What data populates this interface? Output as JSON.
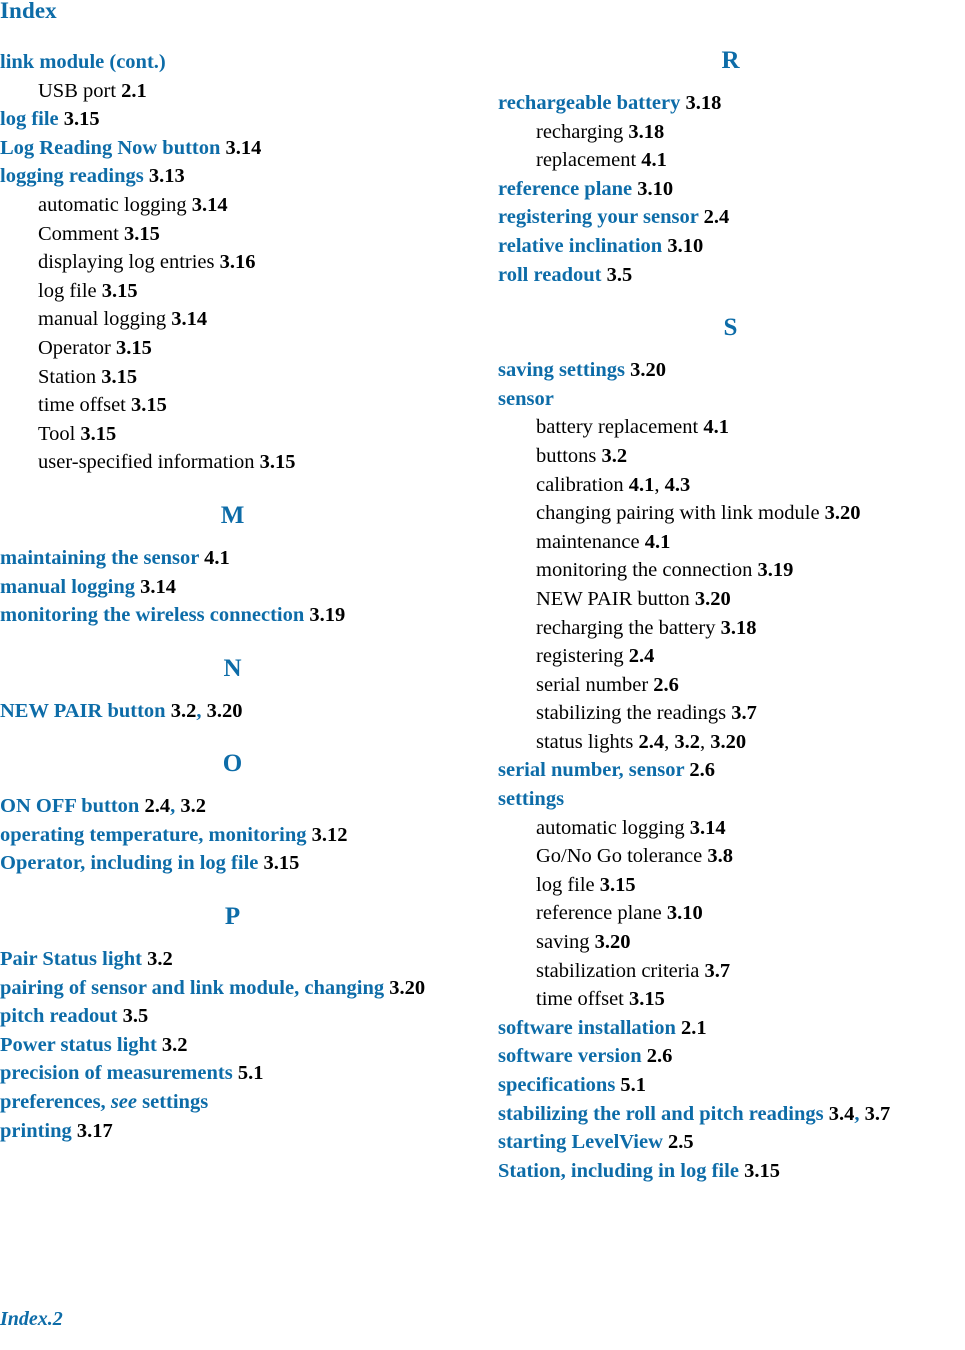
{
  "page": {
    "title": "Index",
    "footer": "Index.2"
  },
  "columns": [
    {
      "id": "left",
      "groups": [
        {
          "letter": null,
          "entries": [
            {
              "label": "link module (cont.)",
              "pages": [],
              "subs": [
                {
                  "label": "USB port",
                  "pages": [
                    "2.1"
                  ]
                }
              ]
            },
            {
              "label": "log file",
              "pages": [
                "3.15"
              ],
              "subs": []
            },
            {
              "label": "Log Reading Now button",
              "pages": [
                "3.14"
              ],
              "subs": []
            },
            {
              "label": "logging readings",
              "pages": [
                "3.13"
              ],
              "subs": [
                {
                  "label": "automatic logging",
                  "pages": [
                    "3.14"
                  ]
                },
                {
                  "label": "Comment",
                  "pages": [
                    "3.15"
                  ]
                },
                {
                  "label": "displaying log entries",
                  "pages": [
                    "3.16"
                  ]
                },
                {
                  "label": "log file",
                  "pages": [
                    "3.15"
                  ]
                },
                {
                  "label": "manual logging",
                  "pages": [
                    "3.14"
                  ]
                },
                {
                  "label": "Operator",
                  "pages": [
                    "3.15"
                  ]
                },
                {
                  "label": "Station",
                  "pages": [
                    "3.15"
                  ]
                },
                {
                  "label": "time offset",
                  "pages": [
                    "3.15"
                  ]
                },
                {
                  "label": "Tool",
                  "pages": [
                    "3.15"
                  ]
                },
                {
                  "label": "user-specified information",
                  "pages": [
                    "3.15"
                  ]
                }
              ]
            }
          ]
        },
        {
          "letter": "M",
          "entries": [
            {
              "label": "maintaining the sensor",
              "pages": [
                "4.1"
              ],
              "subs": []
            },
            {
              "label": "manual logging",
              "pages": [
                "3.14"
              ],
              "subs": []
            },
            {
              "label": "monitoring the wireless connection",
              "pages": [
                "3.19"
              ],
              "subs": []
            }
          ]
        },
        {
          "letter": "N",
          "entries": [
            {
              "label": "NEW PAIR button",
              "pages": [
                "3.2",
                "3.20"
              ],
              "subs": []
            }
          ]
        },
        {
          "letter": "O",
          "entries": [
            {
              "label": "ON OFF button",
              "pages": [
                "2.4",
                "3.2"
              ],
              "subs": []
            },
            {
              "label": "operating temperature, monitoring",
              "pages": [
                "3.12"
              ],
              "subs": []
            },
            {
              "label": "Operator, including in log file",
              "pages": [
                "3.15"
              ],
              "subs": []
            }
          ]
        },
        {
          "letter": "P",
          "entries": [
            {
              "label": "Pair Status light",
              "pages": [
                "3.2"
              ],
              "subs": []
            },
            {
              "label": "pairing of sensor and link module, changing",
              "pages": [
                "3.20"
              ],
              "wrap": true,
              "subs": []
            },
            {
              "label": "pitch readout",
              "pages": [
                "3.5"
              ],
              "subs": []
            },
            {
              "label": "Power status light",
              "pages": [
                "3.2"
              ],
              "subs": []
            },
            {
              "label": "precision of measurements",
              "pages": [
                "5.1"
              ],
              "subs": []
            },
            {
              "label": "preferences,",
              "see": "see",
              "after_see": "settings",
              "pages": [],
              "subs": []
            },
            {
              "label": "printing",
              "pages": [
                "3.17"
              ],
              "subs": []
            }
          ]
        }
      ]
    },
    {
      "id": "right",
      "groups": [
        {
          "letter": "R",
          "entries": [
            {
              "label": "rechargeable battery",
              "pages": [
                "3.18"
              ],
              "subs": [
                {
                  "label": "recharging",
                  "pages": [
                    "3.18"
                  ]
                },
                {
                  "label": "replacement",
                  "pages": [
                    "4.1"
                  ]
                }
              ]
            },
            {
              "label": "reference plane",
              "pages": [
                "3.10"
              ],
              "subs": []
            },
            {
              "label": "registering your sensor",
              "pages": [
                "2.4"
              ],
              "subs": []
            },
            {
              "label": "relative inclination",
              "pages": [
                "3.10"
              ],
              "subs": []
            },
            {
              "label": "roll readout",
              "pages": [
                "3.5"
              ],
              "subs": []
            }
          ]
        },
        {
          "letter": "S",
          "entries": [
            {
              "label": "saving settings",
              "pages": [
                "3.20"
              ],
              "subs": []
            },
            {
              "label": "sensor",
              "pages": [],
              "subs": [
                {
                  "label": "battery replacement",
                  "pages": [
                    "4.1"
                  ]
                },
                {
                  "label": "buttons",
                  "pages": [
                    "3.2"
                  ]
                },
                {
                  "label": "calibration",
                  "pages": [
                    "4.1",
                    "4.3"
                  ]
                },
                {
                  "label": "changing pairing with link module",
                  "pages": [
                    "3.20"
                  ]
                },
                {
                  "label": "maintenance",
                  "pages": [
                    "4.1"
                  ]
                },
                {
                  "label": "monitoring the connection",
                  "pages": [
                    "3.19"
                  ]
                },
                {
                  "label": "NEW PAIR button",
                  "pages": [
                    "3.20"
                  ]
                },
                {
                  "label": "recharging the battery",
                  "pages": [
                    "3.18"
                  ]
                },
                {
                  "label": "registering",
                  "pages": [
                    "2.4"
                  ]
                },
                {
                  "label": "serial number",
                  "pages": [
                    "2.6"
                  ]
                },
                {
                  "label": "stabilizing the readings",
                  "pages": [
                    "3.7"
                  ]
                },
                {
                  "label": "status lights",
                  "pages": [
                    "2.4",
                    "3.2",
                    "3.20"
                  ]
                }
              ]
            },
            {
              "label": "serial number, sensor",
              "pages": [
                "2.6"
              ],
              "subs": []
            },
            {
              "label": "settings",
              "pages": [],
              "subs": [
                {
                  "label": "automatic logging",
                  "pages": [
                    "3.14"
                  ]
                },
                {
                  "label": "Go/No Go tolerance",
                  "pages": [
                    "3.8"
                  ]
                },
                {
                  "label": "log file",
                  "pages": [
                    "3.15"
                  ]
                },
                {
                  "label": "reference plane",
                  "pages": [
                    "3.10"
                  ]
                },
                {
                  "label": "saving",
                  "pages": [
                    "3.20"
                  ]
                },
                {
                  "label": "stabilization criteria",
                  "pages": [
                    "3.7"
                  ]
                },
                {
                  "label": "time offset",
                  "pages": [
                    "3.15"
                  ]
                }
              ]
            },
            {
              "label": "software installation",
              "pages": [
                "2.1"
              ],
              "subs": []
            },
            {
              "label": "software version",
              "pages": [
                "2.6"
              ],
              "subs": []
            },
            {
              "label": "specifications",
              "pages": [
                "5.1"
              ],
              "subs": []
            },
            {
              "label": "stabilizing the roll and pitch readings",
              "pages": [
                "3.4",
                "3.7"
              ],
              "subs": []
            },
            {
              "label": "starting LevelView",
              "pages": [
                "2.5"
              ],
              "subs": []
            },
            {
              "label": "Station, including in log file",
              "pages": [
                "3.15"
              ],
              "subs": []
            }
          ]
        }
      ]
    }
  ],
  "colors": {
    "accent_blue": "#0d6ca8",
    "body_black": "#000000"
  }
}
